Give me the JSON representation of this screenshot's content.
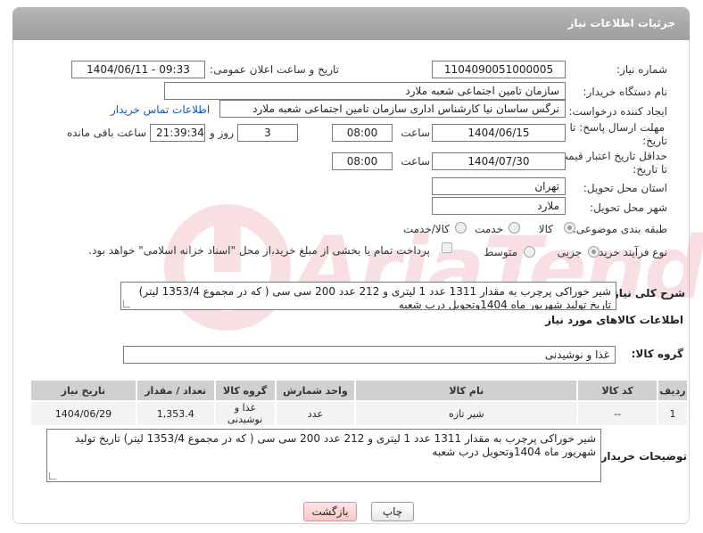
{
  "header": {
    "title": "جزئیات اطلاعات نیاز"
  },
  "form": {
    "need_number_label": "شماره نیاز:",
    "need_number": "1104090051000005",
    "announce_label": "تاریخ و ساعت اعلان عمومی:",
    "announce_value": "1404/06/11 - 09:33",
    "buyer_org_label": "نام دستگاه خریدار:",
    "buyer_org": "سازمان تامین اجتماعی شعبه ملارد",
    "requester_label": "ایجاد کننده درخواست:",
    "requester": "نرگس ساسان نیا کارشناس اداری سازمان تامین اجتماعی شعبه ملارد",
    "contact_link": "اطلاعات تماس خریدار",
    "reply_deadline_label_1": "مهلت ارسال پاسخ: تا",
    "reply_deadline_label_2": "تاریخ:",
    "reply_date": "1404/06/15",
    "time_label": "ساعت",
    "reply_time": "08:00",
    "days_value": "3",
    "days_label": "روز و",
    "remaining_time": "21:39:34",
    "remaining_label": "ساعت باقی مانده",
    "price_validity_label_1": "حداقل تاریخ اعتبار قیمت:",
    "price_validity_label_2": "تا تاریخ:",
    "price_date": "1404/07/30",
    "price_time": "08:00",
    "province_label": "استان محل تحویل:",
    "province": "تهران",
    "city_label": "شهر محل تحویل:",
    "city": "ملارد",
    "category_label": "طبقه بندی موضوعی:",
    "category_options": [
      "کالا",
      "خدمت",
      "کالا/خدمت"
    ],
    "process_label": "نوع فرآیند خرید :",
    "process_options": [
      "جزیی",
      "متوسط"
    ],
    "payment_note": "پرداخت تمام یا بخشی از مبلغ خرید،از محل \"اسناد خزانه اسلامی\" خواهد بود."
  },
  "description": {
    "label": "شرح کلی نیاز:",
    "text": "شیر خوراکی پرچرب به مقدار 1311 عدد 1 لیتری و 212 عدد 200 سی سی ( که در مجموع 1353/4 لیتر) تاریخ تولید شهریور ماه 1404وتحویل درب شعبه"
  },
  "goods": {
    "section_title": "اطلاعات کالاهای مورد نیاز",
    "group_label": "گروه کالا:",
    "group_value": "غذا و نوشیدنی",
    "columns": [
      "ردیف",
      "کد کالا",
      "نام کالا",
      "واحد شمارش",
      "گروه کالا",
      "تعداد / مقدار",
      "تاریخ نیاز"
    ],
    "rows": [
      [
        "1",
        "--",
        "شیر تازه",
        "عدد",
        "غذا و نوشیدنی",
        "1,353.4",
        "1404/06/29"
      ]
    ]
  },
  "buyer_notes": {
    "label": "توضیحات خریدار:",
    "text": "شیر خوراکی پرچرب به مقدار 1311 عدد 1 لیتری و 212 عدد 200 سی سی ( که در مجموع 1353/4 لیتر) تاریخ تولید شهریور ماه 1404وتحویل درب شعبه"
  },
  "buttons": {
    "print": "چاپ",
    "back": "بازگشت"
  },
  "watermark": {
    "text": "AriaTender.net"
  }
}
